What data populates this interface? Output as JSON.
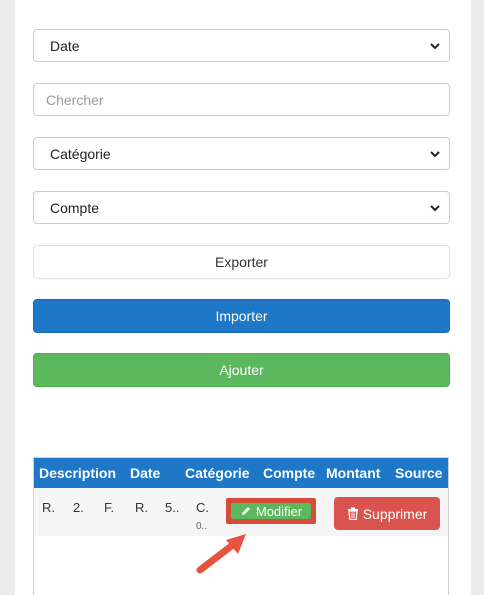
{
  "filters": {
    "date_select": "Date",
    "search_placeholder": "Chercher",
    "category_select": "Catégorie",
    "account_select": "Compte"
  },
  "actions": {
    "export_label": "Exporter",
    "import_label": "Importer",
    "add_label": "Ajouter"
  },
  "table": {
    "headers": [
      "Description",
      "Date",
      "Catégorie",
      "Compte",
      "Montant",
      "Source"
    ],
    "row": {
      "cells": [
        "R.",
        "2.",
        "F.",
        "R.",
        "5..",
        "C."
      ],
      "sub": "0..",
      "modify_label": "Modifier",
      "delete_label": "Supprimer"
    }
  },
  "colors": {
    "primary": "#1f77c8",
    "success": "#5cb85c",
    "danger": "#d9534f",
    "highlight": "#d64b3a"
  },
  "icons": {
    "select_chevron": "chevron-down-icon",
    "modify": "pencil-icon",
    "delete": "trash-icon",
    "annotation": "arrow-icon"
  }
}
